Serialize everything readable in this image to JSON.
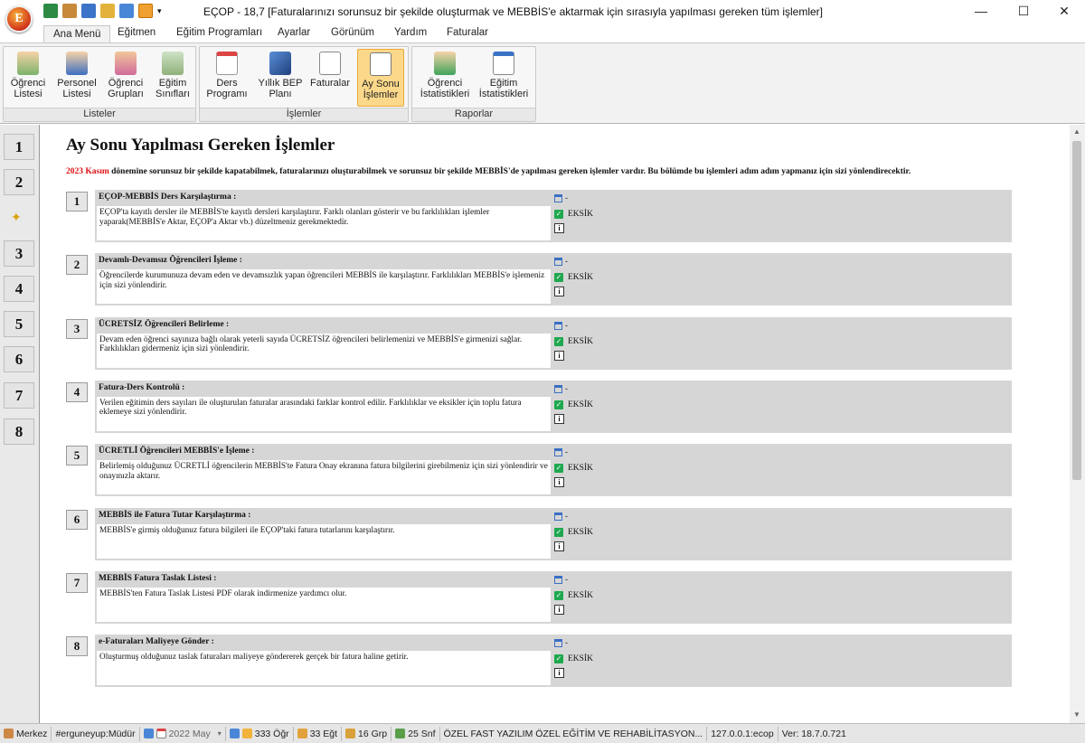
{
  "window": {
    "title": "EÇOP - 18,7 [Faturalarınızı sorunsuz bir şekilde oluşturmak ve MEBBİS'e aktarmak için sırasıyla yapılması gereken tüm işlemler]",
    "orb_letter": "E",
    "minimize": "—",
    "maximize": "☐",
    "close": "✕"
  },
  "tabs": [
    "Ana Menü",
    "Eğitmen",
    "Eğitim Programları",
    "Ayarlar",
    "Görünüm",
    "Yardım",
    "Faturalar"
  ],
  "ribbon": {
    "groups": [
      {
        "label": "Listeler",
        "buttons": [
          {
            "line1": "Öğrenci",
            "line2": "Listesi",
            "icon": "student-icon"
          },
          {
            "line1": "Personel",
            "line2": "Listesi",
            "icon": "staff-icon"
          },
          {
            "line1": "Öğrenci",
            "line2": "Grupları",
            "icon": "student-groups-icon"
          },
          {
            "line1": "Eğitim",
            "line2": "Sınıfları",
            "icon": "classroom-icon"
          }
        ]
      },
      {
        "label": "İşlemler",
        "buttons": [
          {
            "line1": "Ders",
            "line2": "Programı",
            "icon": "calendar-icon"
          },
          {
            "line1": "Yıllık BEP",
            "line2": "Planı",
            "icon": "cube-icon"
          },
          {
            "line1": "Faturalar",
            "line2": "",
            "icon": "invoice-icon"
          },
          {
            "line1": "Ay Sonu",
            "line2": "İşlemler",
            "icon": "checklist-edit-icon"
          }
        ]
      },
      {
        "label": "Raporlar",
        "buttons": [
          {
            "line1": "Öğrenci",
            "line2": "İstatistikleri",
            "icon": "student-stats-icon"
          },
          {
            "line1": "Eğitim",
            "line2": "İstatistikleri",
            "icon": "education-stats-icon"
          }
        ]
      }
    ]
  },
  "leftnav": [
    "1",
    "2",
    "3",
    "4",
    "5",
    "6",
    "7",
    "8"
  ],
  "page": {
    "title": "Ay Sonu Yapılması Gereken İşlemler",
    "period": "2023 Kasım",
    "intro": " dönemine sorunsuz bir şekilde kapatabilmek, faturalarınızı oluşturabilmek ve sorunsuz bir şekilde MEBBİS'de yapılması gereken işlemler vardır. Bu bölümde bu işlemleri adım adım yapmanız için sizi yönlendirecektir."
  },
  "steps": [
    {
      "num": "1",
      "title": "EÇOP-MEBBİS Ders Karşılaştırma :",
      "desc": "EÇOP'ta kayıtlı dersler ile MEBBİS'te kayıtlı dersleri karşılaştırır. Farklı olanları gösterir ve bu farklılıkları işlemler yaparak(MEBBİS'e Aktar, EÇOP'a Aktar vb.) düzeltmeniz gerekmektedir.",
      "date": "-",
      "status": "EKSİK"
    },
    {
      "num": "2",
      "title": "Devamlı-Devamsız Öğrencileri İşleme :",
      "desc": "Öğrencilerde kurumunuza devam eden ve devamsızlık yapan öğrencileri MEBBİS ile karşılaştırır. Farklılıkları MEBBİS'e işlemeniz için sizi yönlendirir.",
      "date": "-",
      "status": "EKSİK"
    },
    {
      "num": "3",
      "title": "ÜCRETSİZ Öğrencileri Belirleme :",
      "desc": "Devam eden öğrenci sayınıza bağlı olarak yeterli sayıda ÜCRETSİZ öğrencileri belirlemenizi ve MEBBİS'e girmenizi sağlar. Farklılıkları gidermeniz için sizi yönlendirir.",
      "date": "-",
      "status": "EKSİK"
    },
    {
      "num": "4",
      "title": "Fatura-Ders Kontrolü :",
      "desc": "Verilen eğitimin ders sayıları ile oluşturulan faturalar arasındaki farklar kontrol edilir. Farklılıklar ve eksikler için toplu fatura eklemeye sizi yönlendirir.",
      "date": "-",
      "status": "EKSİK"
    },
    {
      "num": "5",
      "title": "ÜCRETLİ Öğrencileri MEBBİS'e İşleme :",
      "desc": "Belirlemiş olduğunuz ÜCRETLİ öğrencilerin MEBBİS'te Fatura Onay ekranına fatura bilgilerini girebilmeniz için sizi yönlendirir ve onayınızla aktarır.",
      "date": "-",
      "status": "EKSİK"
    },
    {
      "num": "6",
      "title": "MEBBİS ile Fatura Tutar Karşılaştırma :",
      "desc": "MEBBİS'e girmiş olduğunuz fatura bilgileri ile EÇOP'taki fatura tutarlarını karşılaştırır.",
      "date": "-",
      "status": "EKSİK"
    },
    {
      "num": "7",
      "title": "MEBBİS Fatura Taslak Listesi :",
      "desc": "MEBBİS'ten Fatura Taslak Listesi PDF olarak indirmenize yardımcı olur.",
      "date": "-",
      "status": "EKSİK"
    },
    {
      "num": "8",
      "title": "e-Faturaları Maliyeye Gönder :",
      "desc": "Oluşturmuş olduğunuz taslak faturaları maliyeye göndererek gerçek bir fatura haline getirir.",
      "date": "-",
      "status": "EKSİK"
    }
  ],
  "status_bar": {
    "location": "Merkez",
    "user": "#erguneyup:Müdür",
    "period": "2022 May",
    "students": "333 Öğr",
    "trainers": "33 Eğt",
    "groups": "16 Grp",
    "classes": "25 Snf",
    "institution": "ÖZEL FAST YAZILIM ÖZEL EĞİTİM VE REHABİLİTASYON...",
    "server": "127.0.0.1:ecop",
    "version": "Ver: 18.7.0.721"
  },
  "colors": {
    "accent_red": "#dd1111",
    "check_green": "#1fa84f",
    "selected_ribbon": "#fbd88a",
    "step_bg": "#d6d6d6"
  }
}
